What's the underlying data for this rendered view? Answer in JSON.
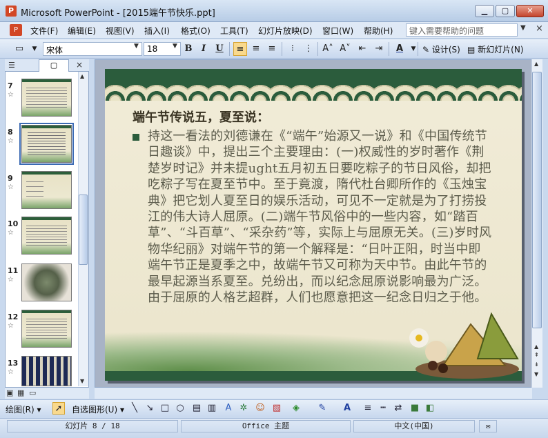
{
  "window": {
    "title": "Microsoft PowerPoint - [2015端午节快乐.ppt]",
    "app_icon": "powerpoint-icon",
    "controls": [
      "minimize",
      "maximize",
      "close"
    ]
  },
  "menu": {
    "items": [
      "文件(F)",
      "编辑(E)",
      "视图(V)",
      "插入(I)",
      "格式(O)",
      "工具(T)",
      "幻灯片放映(D)",
      "窗口(W)",
      "帮助(H)"
    ],
    "help_placeholder": "键入需要帮助的问题"
  },
  "toolbar": {
    "font_name": "宋体",
    "font_size": "18",
    "bold": "B",
    "italic": "I",
    "underline": "U",
    "design_label": "设计(S)",
    "new_slide_label": "新幻灯片(N)",
    "active_alignment": "left"
  },
  "slide_pane": {
    "tabs": [
      "outline",
      "slides"
    ],
    "active_tab": "slides",
    "slides": [
      {
        "number": "7",
        "star": "☆"
      },
      {
        "number": "8",
        "star": "☆",
        "selected": true
      },
      {
        "number": "9",
        "star": "☆"
      },
      {
        "number": "10",
        "star": "☆"
      },
      {
        "number": "11",
        "star": "☆"
      },
      {
        "number": "12",
        "star": "☆"
      },
      {
        "number": "13",
        "star": "☆"
      }
    ]
  },
  "slide": {
    "title": "端午节传说五，夏至说：",
    "body": "持这一看法的刘德谦在《“端午”始源又一说》和《中国传统节日趣谈》中，提出三个主要理由：(一)权威性的岁时著作《荆楚岁时记》并未提ught五月初五日要吃粽子的节日风俗，却把吃粽子写在夏至节中。至于竟渡，隋代杜台卿所作的《玉烛宝典》把它划人夏至日的娱乐活动，可见不一定就是为了打捞投江的伟大诗人屈原。(二)端午节风俗中的一些内容，如“踏百草”、“斗百草”、“采杂药”等，实际上与屈原无关。(三)岁时风物华纪丽》对端午节的第一个解释是：“日叶正阳，时当中即端午节正是夏季之中，故端午节又可称为天中节。由此午节的最早起源当系夏至。兑纷出，而以纪念屈原说影响最为广泛。由于屈原的人格艺超群，人们也愿意把这一纪念日归之于他。"
  },
  "drawing_toolbar": {
    "draw_label": "绘图(R)",
    "autoshapes_label": "自选图形(U)"
  },
  "status": {
    "slide_info": "幻灯片 8 / 18",
    "theme": "Office 主题",
    "language": "中文(中国)"
  },
  "colors": {
    "slide_green": "#2b5c3c",
    "slide_bg": "#f1ecd8",
    "selection_blue": "#3c6bb4"
  }
}
